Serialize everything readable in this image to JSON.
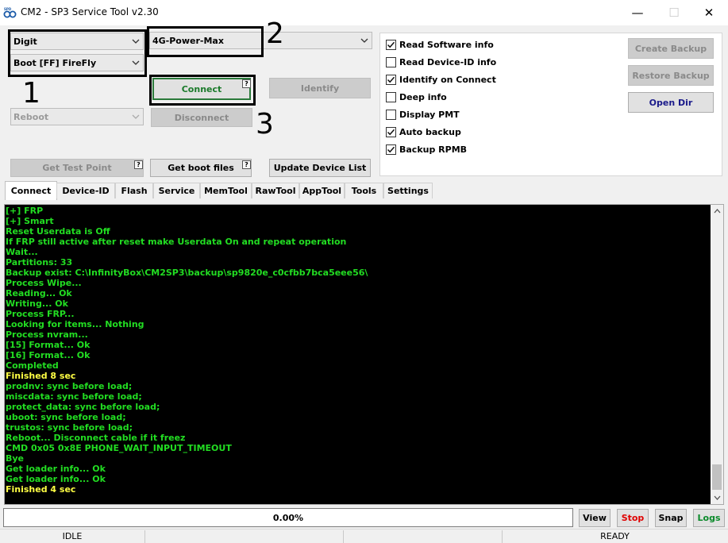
{
  "window": {
    "title": "CM2 - SP3 Service Tool v2.30",
    "logo_label": "SPD",
    "minimize": "—",
    "maximize": "☐",
    "close": "✕"
  },
  "combos": {
    "brand": "Digit",
    "boot": "Boot [FF] FireFly",
    "model": "4G-Power-Max",
    "reboot": "Reboot"
  },
  "buttons": {
    "connect": "Connect",
    "identify": "Identify",
    "disconnect": "Disconnect",
    "get_test_point": "Get Test Point",
    "get_boot_files": "Get boot files",
    "update_device_list": "Update Device List",
    "create_backup": "Create Backup",
    "restore_backup": "Restore Backup",
    "open_dir": "Open Dir",
    "help": "?"
  },
  "annotations": [
    "1",
    "2",
    "3"
  ],
  "options": [
    {
      "label": "Read Software info",
      "checked": true
    },
    {
      "label": "Read Device-ID info",
      "checked": false
    },
    {
      "label": "Identify on Connect",
      "checked": true
    },
    {
      "label": "Deep info",
      "checked": false
    },
    {
      "label": "Display PMT",
      "checked": false
    },
    {
      "label": "Auto backup",
      "checked": true
    },
    {
      "label": "Backup RPMB",
      "checked": true
    }
  ],
  "tabs": [
    "Connect",
    "Device-ID",
    "Flash",
    "Service",
    "MemTool",
    "RawTool",
    "AppTool",
    "Tools",
    "Settings"
  ],
  "active_tab": "Connect",
  "log": [
    {
      "text": "[+] FRP",
      "color": "#22dd22"
    },
    {
      "text": "[+] Smart",
      "color": "#22dd22"
    },
    {
      "text": "Reset Userdata is Off",
      "color": "#22dd22"
    },
    {
      "text": "If FRP still active after reset make Userdata On and repeat operation",
      "color": "#22dd22"
    },
    {
      "text": "Wait...",
      "color": "#22dd22"
    },
    {
      "text": "Partitions: 33",
      "color": "#22dd22"
    },
    {
      "text": "Backup exist: C:\\InfinityBox\\CM2SP3\\backup\\sp9820e_c0cfbb7bca5eee56\\",
      "color": "#22dd22"
    },
    {
      "text": "Process Wipe...",
      "color": "#22dd22"
    },
    {
      "text": "Reading... Ok",
      "color": "#22dd22"
    },
    {
      "text": "Writing... Ok",
      "color": "#22dd22"
    },
    {
      "text": "Process FRP...",
      "color": "#22dd22"
    },
    {
      "text": "Looking for items... Nothing",
      "color": "#22dd22"
    },
    {
      "text": "Process nvram...",
      "color": "#22dd22"
    },
    {
      "text": "[15] Format... Ok",
      "color": "#22dd22"
    },
    {
      "text": "[16] Format... Ok",
      "color": "#22dd22"
    },
    {
      "text": "Completed",
      "color": "#22dd22"
    },
    {
      "text": "Finished 8 sec",
      "color": "#ffff44"
    },
    {
      "text": "prodnv: sync before load;",
      "color": "#22dd22"
    },
    {
      "text": "miscdata: sync before load;",
      "color": "#22dd22"
    },
    {
      "text": "protect_data: sync before load;",
      "color": "#22dd22"
    },
    {
      "text": "uboot: sync before load;",
      "color": "#22dd22"
    },
    {
      "text": "trustos: sync before load;",
      "color": "#22dd22"
    },
    {
      "text": "Reboot... Disconnect cable if it freez",
      "color": "#22dd22"
    },
    {
      "text": "CMD 0x05 0x8E PHONE_WAIT_INPUT_TIMEOUT",
      "color": "#22dd22"
    },
    {
      "text": "Bye",
      "color": "#22dd22"
    },
    {
      "text": "Get loader info... Ok",
      "color": "#22dd22"
    },
    {
      "text": "Get loader info... Ok",
      "color": "#22dd22"
    },
    {
      "text": "Finished 4 sec",
      "color": "#ffff44"
    }
  ],
  "progress": {
    "value": 0.0,
    "label": "0.00%"
  },
  "bottom_buttons": {
    "view": "View",
    "stop": "Stop",
    "snap": "Snap",
    "logs": "Logs"
  },
  "colors": {
    "stop": "#e00000",
    "logs": "#0a8a2a",
    "open_dir": "#1a1a8a"
  },
  "status": {
    "left": "IDLE",
    "right": "READY"
  }
}
